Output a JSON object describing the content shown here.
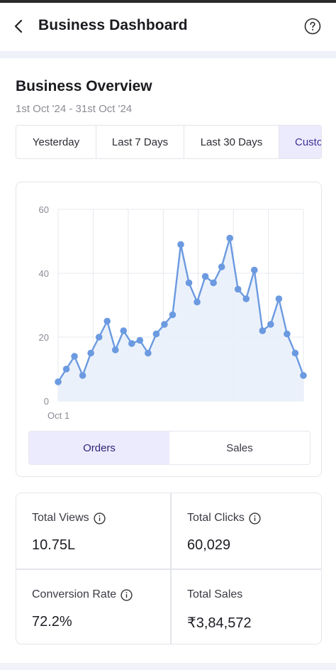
{
  "header": {
    "title": "Business Dashboard",
    "back_icon": "chevron-left-icon",
    "help_icon": "help-circle-icon"
  },
  "overview": {
    "title": "Business Overview",
    "date_range": "1st Oct '24 - 31st Oct '24",
    "tabs": [
      {
        "label": "Yesterday",
        "selected": false
      },
      {
        "label": "Last 7 Days",
        "selected": false
      },
      {
        "label": "Last 30 Days",
        "selected": false
      },
      {
        "label": "Custom",
        "selected": true
      }
    ]
  },
  "chart_data": {
    "type": "line",
    "x_start_label": "Oct 1",
    "ylim": [
      0,
      60
    ],
    "yticks": [
      0,
      20,
      40,
      60
    ],
    "grid": true,
    "colors": {
      "line": "#6b9ae0",
      "point": "#6b9ae0",
      "area": "#e9effb"
    },
    "values": [
      6,
      10,
      14,
      8,
      15,
      20,
      25,
      16,
      22,
      18,
      19,
      15,
      21,
      24,
      27,
      49,
      37,
      31,
      39,
      37,
      42,
      51,
      35,
      32,
      41,
      22,
      24,
      32,
      21,
      15,
      8
    ]
  },
  "toggle": {
    "options": [
      "Orders",
      "Sales"
    ],
    "active": "Orders"
  },
  "stats": {
    "views": {
      "label": "Total Views",
      "value": "10.75L"
    },
    "clicks": {
      "label": "Total Clicks",
      "value": "60,029"
    },
    "conversion": {
      "label": "Conversion Rate",
      "value": "72.2%"
    },
    "sales": {
      "label": "Total Sales",
      "value": "₹3,84,572"
    }
  }
}
